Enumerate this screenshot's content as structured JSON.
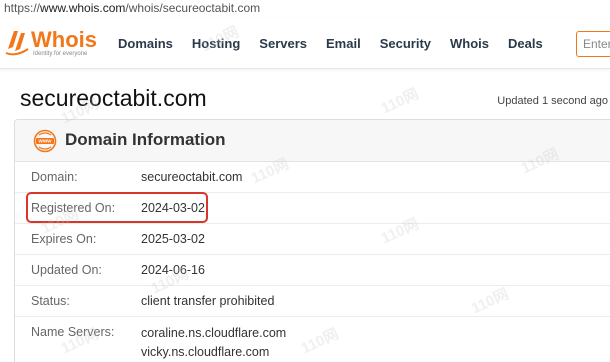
{
  "browser": {
    "url_prefix": "https://",
    "url_host": "www.whois.com",
    "url_path": "/whois/secureoctabit.com"
  },
  "header": {
    "logo_text": "Whois",
    "logo_tagline": "Identity for everyone",
    "nav": [
      "Domains",
      "Hosting",
      "Servers",
      "Email",
      "Security",
      "Whois",
      "Deals"
    ],
    "search_placeholder": "Enter"
  },
  "page": {
    "title": "secureoctabit.com",
    "updated": "Updated 1 second ago"
  },
  "card": {
    "title": "Domain Information",
    "rows": [
      {
        "label": "Domain:",
        "value": "secureoctabit.com"
      },
      {
        "label": "Registered On:",
        "value": "2024-03-02"
      },
      {
        "label": "Expires On:",
        "value": "2025-03-02"
      },
      {
        "label": "Updated On:",
        "value": "2024-06-16"
      },
      {
        "label": "Status:",
        "value": "client transfer prohibited"
      },
      {
        "label": "Name Servers:",
        "values": [
          "coraline.ns.cloudflare.com",
          "vicky.ns.cloudflare.com"
        ]
      }
    ]
  },
  "colors": {
    "brand": "#f2771a",
    "highlight": "#d9362b"
  },
  "watermark": "110网"
}
